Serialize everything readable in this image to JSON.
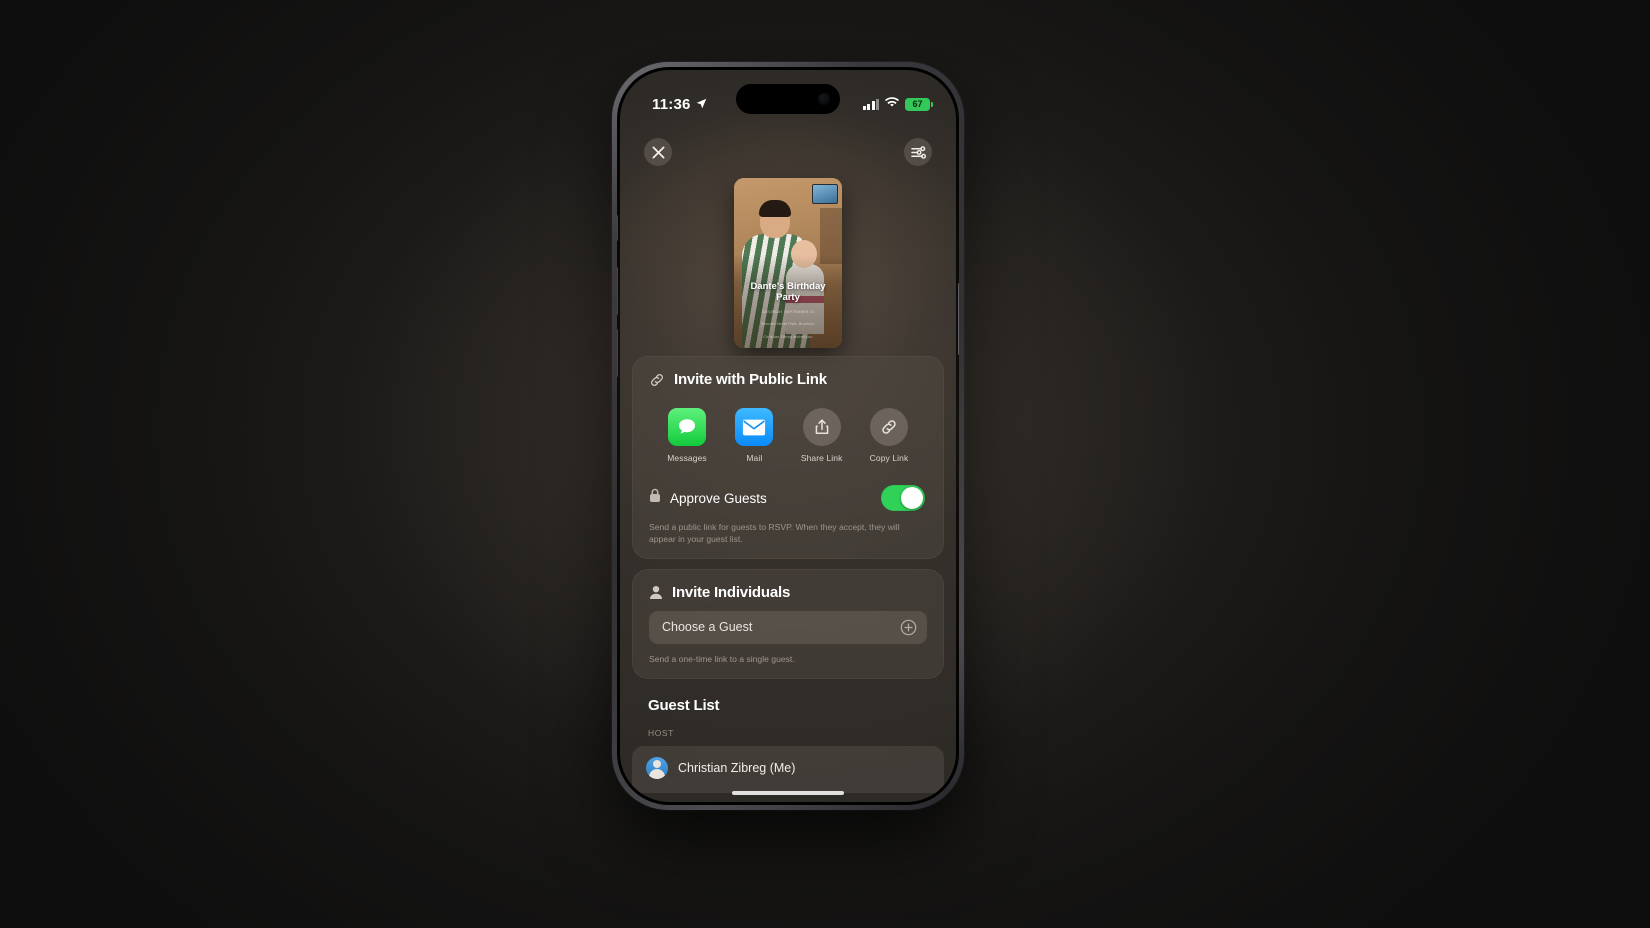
{
  "status_bar": {
    "time": "11:36",
    "location_icon": "location-arrow-icon",
    "cellular_icon": "cellular-signal-icon",
    "wifi_icon": "wifi-icon",
    "battery_level": "67"
  },
  "top_bar": {
    "close_label": "✕",
    "close_icon": "close-icon",
    "options_icon": "sliders-icon"
  },
  "invitation_card": {
    "title": "Dante's Birthday\nParty",
    "title_line1": "Dante's Birthday",
    "title_line2": "Party",
    "meta_line1": "SATURDAY, SEPTEMBER 21",
    "meta_line2": "Wonder Street Park, Brooklyn",
    "meta_line3": "Christian Zibreg invited you"
  },
  "public_link": {
    "icon": "link-icon",
    "title": "Invite with Public Link",
    "share_options": [
      {
        "label": "Messages",
        "icon": "messages-icon"
      },
      {
        "label": "Mail",
        "icon": "mail-icon"
      },
      {
        "label": "Share Link",
        "icon": "share-icon"
      },
      {
        "label": "Copy Link",
        "icon": "link-icon"
      }
    ],
    "approve_guests": {
      "icon": "lock-icon",
      "label": "Approve Guests",
      "enabled_color": "#30d158",
      "state": "on"
    },
    "caption": "Send a public link for guests to RSVP. When they accept, they will appear in your guest list."
  },
  "invite_individuals": {
    "icon": "person-icon",
    "title": "Invite Individuals",
    "choose_guest_label": "Choose a Guest",
    "add_icon": "plus-circle-icon",
    "caption": "Send a one-time link to a single guest."
  },
  "guest_list": {
    "title": "Guest List",
    "group_label": "HOST",
    "members": [
      {
        "name": "Christian Zibreg (Me)",
        "avatar": "user-avatar"
      }
    ]
  }
}
